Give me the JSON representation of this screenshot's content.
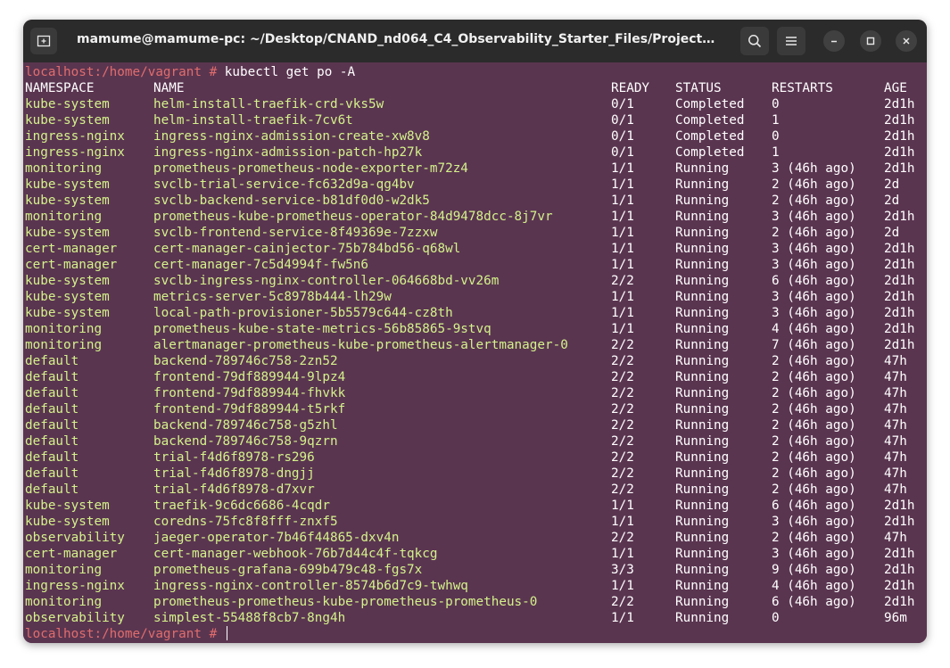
{
  "window": {
    "title": "mamume@mamume-pc: ~/Desktop/CNAND_nd064_C4_Observability_Starter_Files/Project_Starter_F..."
  },
  "icons": {
    "new_tab": "new-tab-icon",
    "search": "search-icon",
    "menu": "hamburger-menu-icon",
    "minimize": "minimize-icon",
    "maximize": "maximize-icon",
    "close": "close-icon"
  },
  "colors": {
    "terminal_bg": "#5a3550",
    "prompt": "#e06d6d",
    "titlebar": "#2b2b2b"
  },
  "terminal": {
    "prompt": "localhost:/home/vagrant # ",
    "command": "kubectl get po -A",
    "headers": {
      "namespace": "NAMESPACE",
      "name": "NAME",
      "ready": "READY",
      "status": "STATUS",
      "restarts": "RESTARTS",
      "age": "AGE"
    },
    "rows": [
      [
        "kube-system",
        "helm-install-traefik-crd-vks5w",
        "0/1",
        "Completed",
        "0",
        "2d1h"
      ],
      [
        "kube-system",
        "helm-install-traefik-7cv6t",
        "0/1",
        "Completed",
        "1",
        "2d1h"
      ],
      [
        "ingress-nginx",
        "ingress-nginx-admission-create-xw8v8",
        "0/1",
        "Completed",
        "0",
        "2d1h"
      ],
      [
        "ingress-nginx",
        "ingress-nginx-admission-patch-hp27k",
        "0/1",
        "Completed",
        "1",
        "2d1h"
      ],
      [
        "monitoring",
        "prometheus-prometheus-node-exporter-m72z4",
        "1/1",
        "Running",
        "3 (46h ago)",
        "2d1h"
      ],
      [
        "kube-system",
        "svclb-trial-service-fc632d9a-qg4bv",
        "1/1",
        "Running",
        "2 (46h ago)",
        "2d"
      ],
      [
        "kube-system",
        "svclb-backend-service-b81df0d0-w2dk5",
        "1/1",
        "Running",
        "2 (46h ago)",
        "2d"
      ],
      [
        "monitoring",
        "prometheus-kube-prometheus-operator-84d9478dcc-8j7vr",
        "1/1",
        "Running",
        "3 (46h ago)",
        "2d1h"
      ],
      [
        "kube-system",
        "svclb-frontend-service-8f49369e-7zzxw",
        "1/1",
        "Running",
        "2 (46h ago)",
        "2d"
      ],
      [
        "cert-manager",
        "cert-manager-cainjector-75b784bd56-q68wl",
        "1/1",
        "Running",
        "3 (46h ago)",
        "2d1h"
      ],
      [
        "cert-manager",
        "cert-manager-7c5d4994f-fw5n6",
        "1/1",
        "Running",
        "3 (46h ago)",
        "2d1h"
      ],
      [
        "kube-system",
        "svclb-ingress-nginx-controller-064668bd-vv26m",
        "2/2",
        "Running",
        "6 (46h ago)",
        "2d1h"
      ],
      [
        "kube-system",
        "metrics-server-5c8978b444-lh29w",
        "1/1",
        "Running",
        "3 (46h ago)",
        "2d1h"
      ],
      [
        "kube-system",
        "local-path-provisioner-5b5579c644-cz8th",
        "1/1",
        "Running",
        "3 (46h ago)",
        "2d1h"
      ],
      [
        "monitoring",
        "prometheus-kube-state-metrics-56b85865-9stvq",
        "1/1",
        "Running",
        "4 (46h ago)",
        "2d1h"
      ],
      [
        "monitoring",
        "alertmanager-prometheus-kube-prometheus-alertmanager-0",
        "2/2",
        "Running",
        "7 (46h ago)",
        "2d1h"
      ],
      [
        "default",
        "backend-789746c758-2zn52",
        "2/2",
        "Running",
        "2 (46h ago)",
        "47h"
      ],
      [
        "default",
        "frontend-79df889944-9lpz4",
        "2/2",
        "Running",
        "2 (46h ago)",
        "47h"
      ],
      [
        "default",
        "frontend-79df889944-fhvkk",
        "2/2",
        "Running",
        "2 (46h ago)",
        "47h"
      ],
      [
        "default",
        "frontend-79df889944-t5rkf",
        "2/2",
        "Running",
        "2 (46h ago)",
        "47h"
      ],
      [
        "default",
        "backend-789746c758-g5zhl",
        "2/2",
        "Running",
        "2 (46h ago)",
        "47h"
      ],
      [
        "default",
        "backend-789746c758-9qzrn",
        "2/2",
        "Running",
        "2 (46h ago)",
        "47h"
      ],
      [
        "default",
        "trial-f4d6f8978-rs296",
        "2/2",
        "Running",
        "2 (46h ago)",
        "47h"
      ],
      [
        "default",
        "trial-f4d6f8978-dngjj",
        "2/2",
        "Running",
        "2 (46h ago)",
        "47h"
      ],
      [
        "default",
        "trial-f4d6f8978-d7xvr",
        "2/2",
        "Running",
        "2 (46h ago)",
        "47h"
      ],
      [
        "kube-system",
        "traefik-9c6dc6686-4cqdr",
        "1/1",
        "Running",
        "6 (46h ago)",
        "2d1h"
      ],
      [
        "kube-system",
        "coredns-75fc8f8fff-znxf5",
        "1/1",
        "Running",
        "3 (46h ago)",
        "2d1h"
      ],
      [
        "observability",
        "jaeger-operator-7b46f44865-dxv4n",
        "2/2",
        "Running",
        "2 (46h ago)",
        "47h"
      ],
      [
        "cert-manager",
        "cert-manager-webhook-76b7d44c4f-tqkcg",
        "1/1",
        "Running",
        "3 (46h ago)",
        "2d1h"
      ],
      [
        "monitoring",
        "prometheus-grafana-699b479c48-fgs7x",
        "3/3",
        "Running",
        "9 (46h ago)",
        "2d1h"
      ],
      [
        "ingress-nginx",
        "ingress-nginx-controller-8574b6d7c9-twhwq",
        "1/1",
        "Running",
        "4 (46h ago)",
        "2d1h"
      ],
      [
        "monitoring",
        "prometheus-prometheus-kube-prometheus-prometheus-0",
        "2/2",
        "Running",
        "6 (46h ago)",
        "2d1h"
      ],
      [
        "observability",
        "simplest-55488f8cb7-8ng4h",
        "1/1",
        "Running",
        "0",
        "96m"
      ]
    ]
  }
}
